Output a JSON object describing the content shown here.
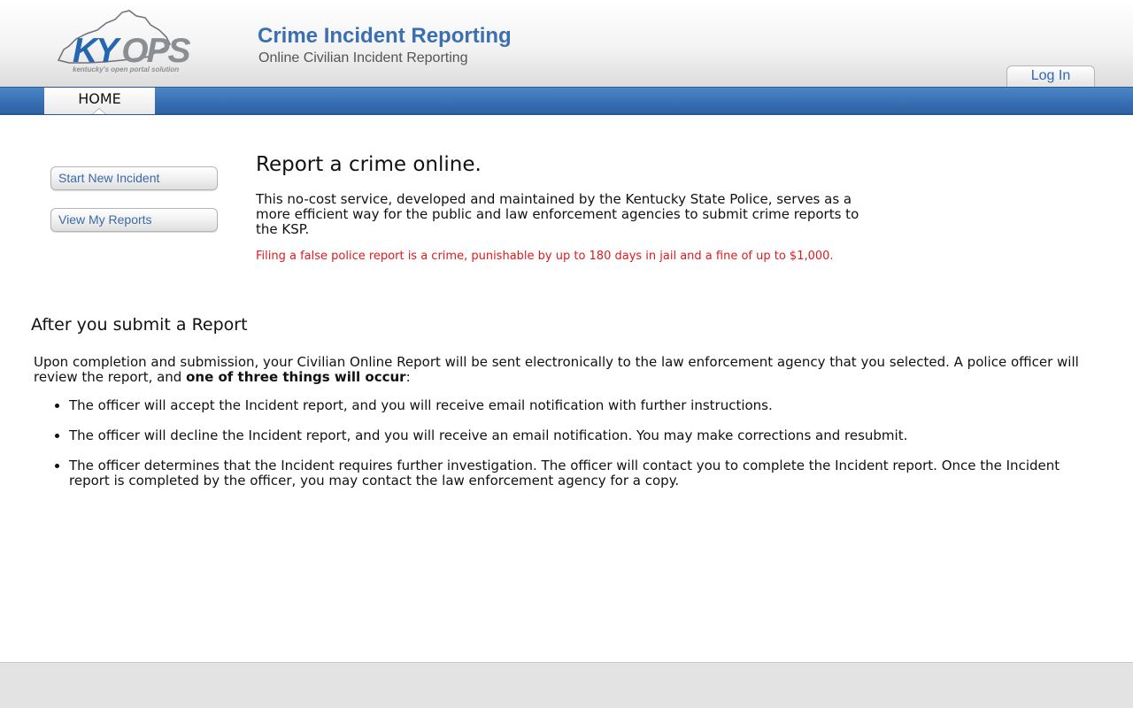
{
  "header": {
    "logo": {
      "ky": "KY",
      "ops": "OPS",
      "tagline": "kentucky's open portal solution"
    },
    "title": "Crime Incident Reporting",
    "subtitle": "Online Civilian Incident Reporting",
    "login_label": "Log In"
  },
  "nav": {
    "tabs": [
      {
        "label": "HOME",
        "active": true
      }
    ]
  },
  "sidebar": {
    "buttons": [
      {
        "label": "Start New Incident"
      },
      {
        "label": "View My Reports"
      }
    ]
  },
  "intro": {
    "heading": "Report a crime online.",
    "text": "This no-cost service, developed and maintained by the Kentucky State Police, serves as a more efficient way for the public and law enforcement agencies to submit crime reports to the KSP.",
    "warning": "Filing a false police report is a crime, punishable by up to 180 days in jail and a fine of up to $1,000."
  },
  "after": {
    "heading": "After you submit a Report",
    "para_lead": "Upon completion and submission, your Civilian Online Report will be sent electronically to the law enforcement agency that you selected. A police officer will review the report, and ",
    "para_bold": "one of three things will occur",
    "para_tail": ":",
    "outcomes": [
      "The officer will accept the Incident report, and you will receive email notification with further instructions.",
      "The officer will decline the Incident report, and you will receive an email notification. You may make corrections and resubmit.",
      "The officer determines that the Incident requires further investigation. The officer will contact you to complete the Incident report. Once the Incident report is completed by the officer, you may contact the law enforcement agency for a copy."
    ]
  },
  "colors": {
    "brand_blue": "#3a6fb0",
    "nav_blue": "#3a72b6",
    "warning_red": "#e0191d",
    "footer_gray": "#e3e3e3"
  }
}
